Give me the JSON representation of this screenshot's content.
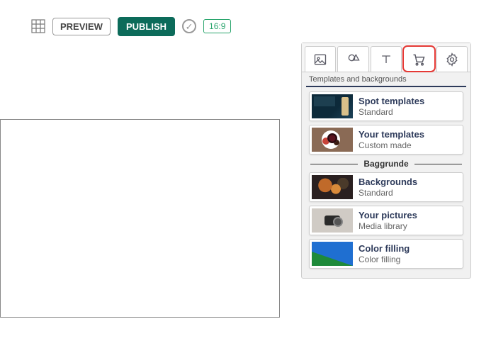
{
  "toolbar": {
    "preview_label": "PREVIEW",
    "publish_label": "PUBLISH",
    "ratio_label": "16:9"
  },
  "panel": {
    "section_templates_label": "Templates and backgrounds",
    "section_backgrounds_label": "Baggrunde",
    "cards": {
      "spot": {
        "title": "Spot templates",
        "sub": "Standard"
      },
      "your_t": {
        "title": "Your templates",
        "sub": "Custom made"
      },
      "bg": {
        "title": "Backgrounds",
        "sub": "Standard"
      },
      "pics": {
        "title": "Your pictures",
        "sub": "Media library"
      },
      "color": {
        "title": "Color filling",
        "sub": "Color filling"
      }
    }
  }
}
